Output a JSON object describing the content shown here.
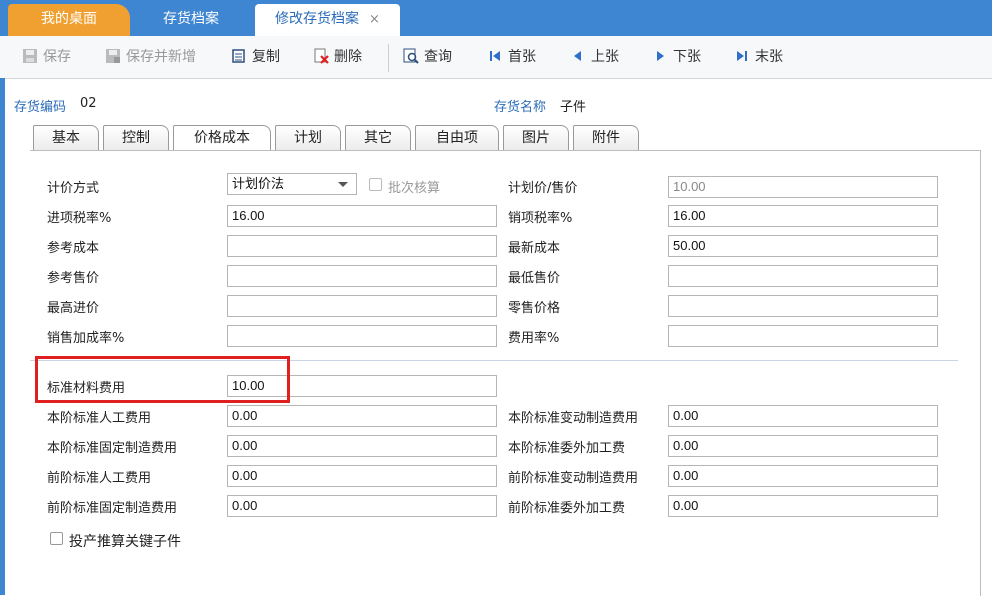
{
  "window_tabs": [
    {
      "label": "我的桌面"
    },
    {
      "label": "存货档案"
    },
    {
      "label": "修改存货档案",
      "close": "×"
    }
  ],
  "toolbar": {
    "save": "保存",
    "save_new": "保存并新增",
    "copy": "复制",
    "delete": "删除",
    "query": "查询",
    "first": "首张",
    "prev": "上张",
    "next": "下张",
    "last": "末张"
  },
  "header": {
    "code_label": "存货编码",
    "code_value": "02",
    "name_label": "存货名称",
    "name_value": "子件"
  },
  "sub_tabs": [
    "基本",
    "控制",
    "价格成本",
    "计划",
    "其它",
    "自由项",
    "图片",
    "附件"
  ],
  "form": {
    "pricing_method_label": "计价方式",
    "pricing_method_value": "计划价法",
    "batch_cost_label": "批次核算",
    "plan_price_label": "计划价/售价",
    "plan_price_value": "10.00",
    "input_tax_label": "进项税率%",
    "input_tax_value": "16.00",
    "output_tax_label": "销项税率%",
    "output_tax_value": "16.00",
    "ref_cost_label": "参考成本",
    "ref_cost_value": "",
    "latest_cost_label": "最新成本",
    "latest_cost_value": "50.00",
    "ref_price_label": "参考售价",
    "ref_price_value": "",
    "min_price_label": "最低售价",
    "min_price_value": "",
    "max_purchase_label": "最高进价",
    "max_purchase_value": "",
    "retail_price_label": "零售价格",
    "retail_price_value": "",
    "markup_label": "销售加成率%",
    "markup_value": "",
    "expense_rate_label": "费用率%",
    "expense_rate_value": "",
    "std_material_label": "标准材料费用",
    "std_material_value": "10.00",
    "cur_labor_label": "本阶标准人工费用",
    "cur_labor_value": "0.00",
    "cur_var_mfg_label": "本阶标准变动制造费用",
    "cur_var_mfg_value": "0.00",
    "cur_fixed_mfg_label": "本阶标准固定制造费用",
    "cur_fixed_mfg_value": "0.00",
    "cur_outsource_label": "本阶标准委外加工费",
    "cur_outsource_value": "0.00",
    "prev_labor_label": "前阶标准人工费用",
    "prev_labor_value": "0.00",
    "prev_var_mfg_label": "前阶标准变动制造费用",
    "prev_var_mfg_value": "0.00",
    "prev_fixed_mfg_label": "前阶标准固定制造费用",
    "prev_fixed_mfg_value": "0.00",
    "prev_outsource_label": "前阶标准委外加工费",
    "prev_outsource_value": "0.00",
    "key_child_label": "投产推算关键子件"
  },
  "colors": {
    "accent": "#3f86d2",
    "home_tab": "#f0a030",
    "highlight": "#e02020",
    "label_blue": "#2b6cb8"
  }
}
